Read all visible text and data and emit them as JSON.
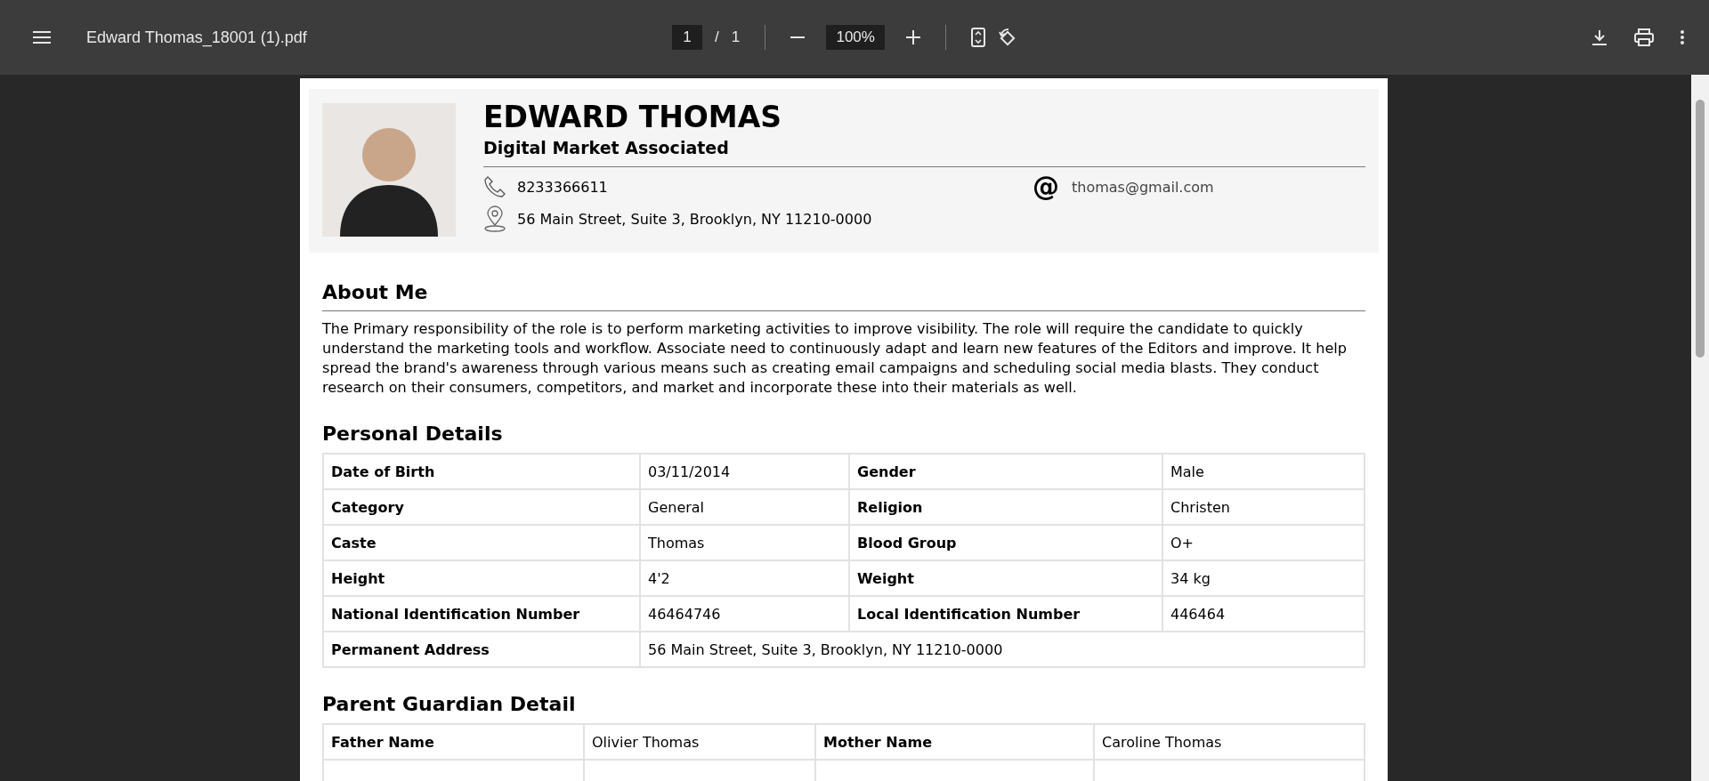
{
  "toolbar": {
    "title": "Edward Thomas_18001 (1).pdf",
    "page": "1",
    "page_separator": "/",
    "page_count": "1",
    "zoom": "100%"
  },
  "document": {
    "header": {
      "name": "EDWARD THOMAS",
      "role": "Digital Market Associated",
      "phone": "8233366611",
      "email_icon": "@",
      "email": "thomas@gmail.com",
      "address": "56 Main Street, Suite 3, Brooklyn, NY 11210-0000"
    },
    "about": {
      "title": "About Me",
      "text": "The Primary responsibility of the role is to perform marketing activities to improve visibility. The role will require the candidate to quickly understand the marketing tools and workflow. Associate need to continuously adapt and learn new features of the Editors and improve. It help spread the brand's awareness through various means such as creating email campaigns and scheduling social media blasts. They conduct research on their consumers, competitors, and market and incorporate these into their materials as well."
    },
    "personal": {
      "title": "Personal Details",
      "rows": [
        {
          "cells": [
            "Date of Birth",
            "03/11/2014",
            "Gender",
            "Male"
          ]
        },
        {
          "cells": [
            "Category",
            "General",
            "Religion",
            "Christen"
          ]
        },
        {
          "cells": [
            "Caste",
            "Thomas",
            "Blood Group",
            "O+"
          ]
        },
        {
          "cells": [
            "Height",
            "4'2",
            "Weight",
            "34 kg"
          ]
        },
        {
          "cells": [
            "National Identification Number",
            "46464746",
            "Local Identification Number",
            "446464"
          ]
        }
      ],
      "address_row": {
        "label": "Permanent Address",
        "value": "56 Main Street, Suite 3, Brooklyn, NY 11210-0000"
      }
    },
    "parent": {
      "title": "Parent Guardian Detail",
      "rows": [
        {
          "cells": [
            "Father Name",
            "Olivier Thomas",
            "Mother Name",
            "Caroline Thomas"
          ]
        }
      ]
    }
  }
}
